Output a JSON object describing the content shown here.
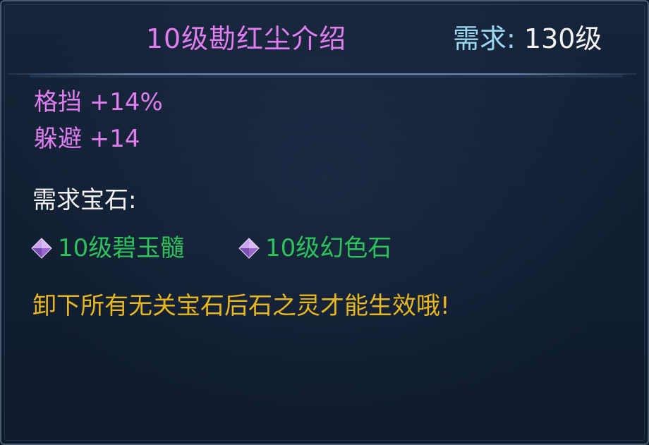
{
  "title": "10级勘红尘介绍",
  "requirement": {
    "label": "需求:",
    "value": "130级"
  },
  "stats": [
    {
      "text": "格挡 +14%"
    },
    {
      "text": "躲避 +14"
    }
  ],
  "gems": {
    "header": "需求宝石:",
    "items": [
      {
        "icon": "purple-gem-icon",
        "text": "10级碧玉髓"
      },
      {
        "icon": "purple-gem-icon",
        "text": "10级幻色石"
      }
    ]
  },
  "note": "卸下所有无关宝石后石之灵才能生效哦!",
  "colors": {
    "title": "#e07ef0",
    "requirement_label": "#9ad8ef",
    "stat": "#e07ef0",
    "gem_name": "#2ec25a",
    "note": "#e8b61e",
    "background": "#121f33"
  }
}
